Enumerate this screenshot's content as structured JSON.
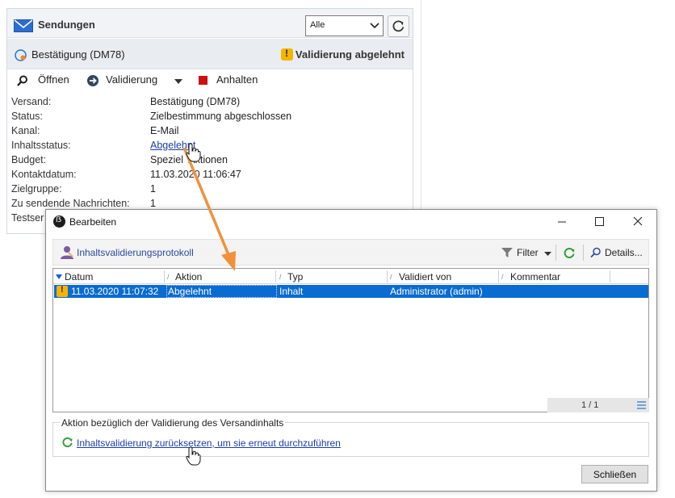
{
  "background": {
    "title": "Sendungen",
    "filter_select": "Alle",
    "delivery_name": "Bestätigung (DM78)",
    "status_label": "Validierung abgelehnt",
    "toolbar": {
      "open": "Öffnen",
      "validation": "Validierung",
      "pause": "Anhalten"
    },
    "properties": [
      {
        "key": "Versand:",
        "value": "Bestätigung (DM78)"
      },
      {
        "key": "Status:",
        "value": "Zielbestimmung abgeschlossen"
      },
      {
        "key": "Kanal:",
        "value": "E-Mail"
      },
      {
        "key": "Inhaltsstatus:",
        "value": "Abgelehnt"
      },
      {
        "key": "Budget:",
        "value": "Speziel  Aktionen"
      },
      {
        "key": "Kontaktdatum:",
        "value": "11.03.2020 11:06:47"
      },
      {
        "key": "Zielgruppe:",
        "value": "1"
      },
      {
        "key": "Zu sendende Nachrichten:",
        "value": "1"
      },
      {
        "key": "Testser",
        "value": ""
      }
    ]
  },
  "dialog": {
    "title": "Bearbeiten",
    "toolbar": {
      "protocol": "Inhaltsvalidierungsprotokoll",
      "filter": "Filter",
      "details": "Details..."
    },
    "columns": [
      "Datum",
      "Aktion",
      "Typ",
      "Validiert von",
      "Kommentar"
    ],
    "rows": [
      {
        "datum": "11.03.2020 11:07:32",
        "aktion": "Abgelehnt",
        "typ": "Inhalt",
        "validiert_von": "Administrator (admin)",
        "kommentar": ""
      }
    ],
    "pagination": "1 / 1",
    "action_group_label": "Aktion bezüglich der Validierung des Versandinhalts",
    "action_link": "Inhaltsvalidierung zurücksetzen, um sie erneut durchzuführen",
    "close_button": "Schließen"
  },
  "colors": {
    "selection": "#0a6bd1",
    "arrow": "#f0913a",
    "warning": "#f4b400",
    "link": "#1a3ea8"
  },
  "icons": [
    "envelope-icon",
    "refresh-icon",
    "delivery-icon",
    "warning-icon",
    "search-icon",
    "arrow-circle-icon",
    "stop-icon",
    "app-logo-icon",
    "user-icon",
    "filter-icon",
    "magnifier-icon",
    "hand-cursor-icon"
  ]
}
